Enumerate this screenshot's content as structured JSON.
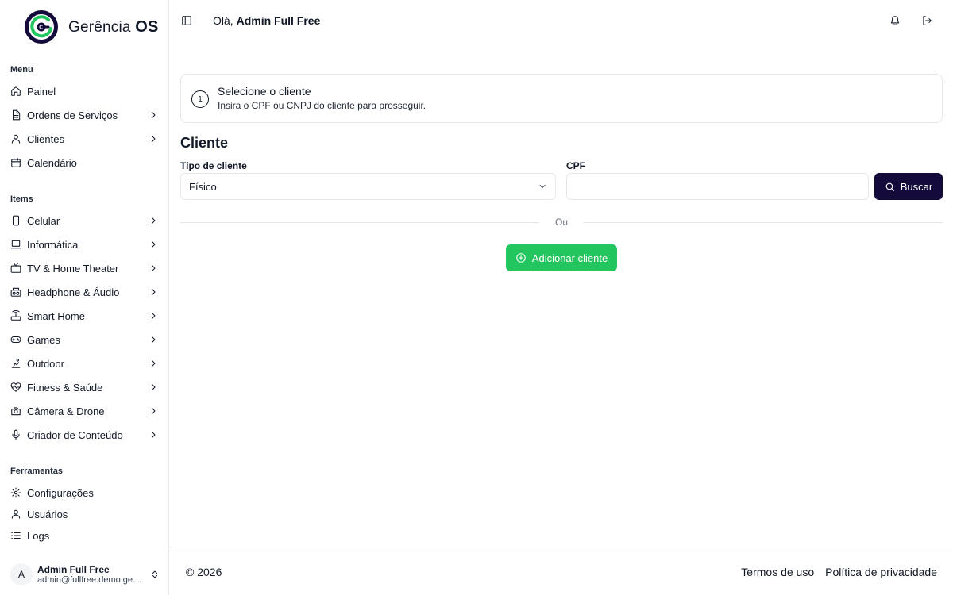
{
  "brand": {
    "name_part1": "Gerência ",
    "name_part2": "OS"
  },
  "sidebar": {
    "menu_label": "Menu",
    "menu": [
      {
        "label": "Painel",
        "icon": "home-icon",
        "has_submenu": false
      },
      {
        "label": "Ordens de Serviços",
        "icon": "document-icon",
        "has_submenu": true
      },
      {
        "label": "Clientes",
        "icon": "user-icon",
        "has_submenu": true
      },
      {
        "label": "Calendário",
        "icon": "calendar-icon",
        "has_submenu": false
      }
    ],
    "items_label": "Items",
    "items": [
      {
        "label": "Celular",
        "icon": "smartphone-icon",
        "has_submenu": true
      },
      {
        "label": "Informática",
        "icon": "laptop-icon",
        "has_submenu": true
      },
      {
        "label": "TV & Home Theater",
        "icon": "tv-icon",
        "has_submenu": true
      },
      {
        "label": "Headphone & Áudio",
        "icon": "boombox-icon",
        "has_submenu": true
      },
      {
        "label": "Smart Home",
        "icon": "router-icon",
        "has_submenu": true
      },
      {
        "label": "Games",
        "icon": "gamepad-icon",
        "has_submenu": true
      },
      {
        "label": "Outdoor",
        "icon": "outdoor-icon",
        "has_submenu": true
      },
      {
        "label": "Fitness & Saúde",
        "icon": "heart-pulse-icon",
        "has_submenu": true
      },
      {
        "label": "Câmera & Drone",
        "icon": "camera-icon",
        "has_submenu": true
      },
      {
        "label": "Criador de Conteúdo",
        "icon": "microphone-icon",
        "has_submenu": true
      }
    ],
    "tools_label": "Ferramentas",
    "tools": [
      {
        "label": "Configurações",
        "icon": "gear-icon"
      },
      {
        "label": "Usuários",
        "icon": "user-icon"
      },
      {
        "label": "Logs",
        "icon": "list-icon"
      }
    ],
    "user": {
      "avatar_initial": "A",
      "name": "Admin Full Free",
      "email": "admin@fullfree.demo.ger..."
    }
  },
  "header": {
    "greeting_prefix": "Olá, ",
    "user_name": "Admin Full Free"
  },
  "step": {
    "number": "1",
    "title": "Selecione o cliente",
    "description": "Insira o CPF ou CNPJ do cliente para prosseguir."
  },
  "form": {
    "section_title": "Cliente",
    "client_type_label": "Tipo de cliente",
    "client_type_value": "Físico",
    "doc_label": "CPF",
    "doc_value": "",
    "search_label": "Buscar",
    "divider_text": "Ou",
    "add_label": "Adicionar cliente"
  },
  "footer": {
    "copyright": "© 2026",
    "terms": "Termos de uso",
    "privacy": "Política de privacidade"
  },
  "colors": {
    "brand_dark": "#140b3b",
    "accent_green": "#22c55e",
    "border": "#e5e7eb"
  }
}
